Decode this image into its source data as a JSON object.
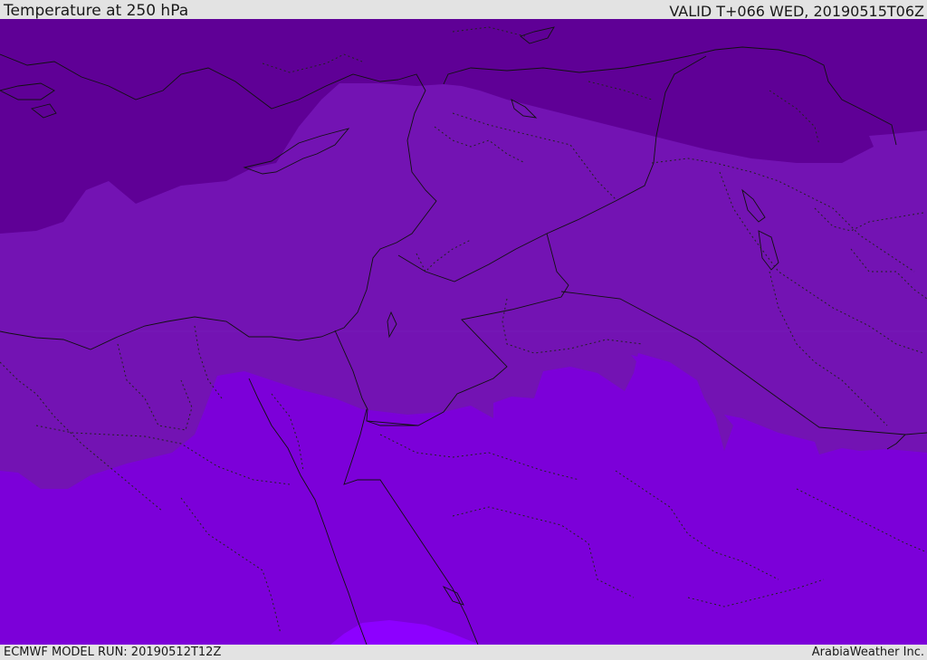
{
  "header": {
    "title": "Temperature at 250 hPa",
    "valid": "VALID T+066 WED, 20190515T06Z"
  },
  "footer": {
    "model_run": "ECMWF MODEL RUN: 20190512T12Z",
    "credit": "ArabiaWeather Inc."
  },
  "map": {
    "field": "temperature",
    "level": "250 hPa",
    "band_colors": [
      "#5f0096",
      "#7313b3",
      "#7c00d9",
      "#8d00ff"
    ]
  }
}
